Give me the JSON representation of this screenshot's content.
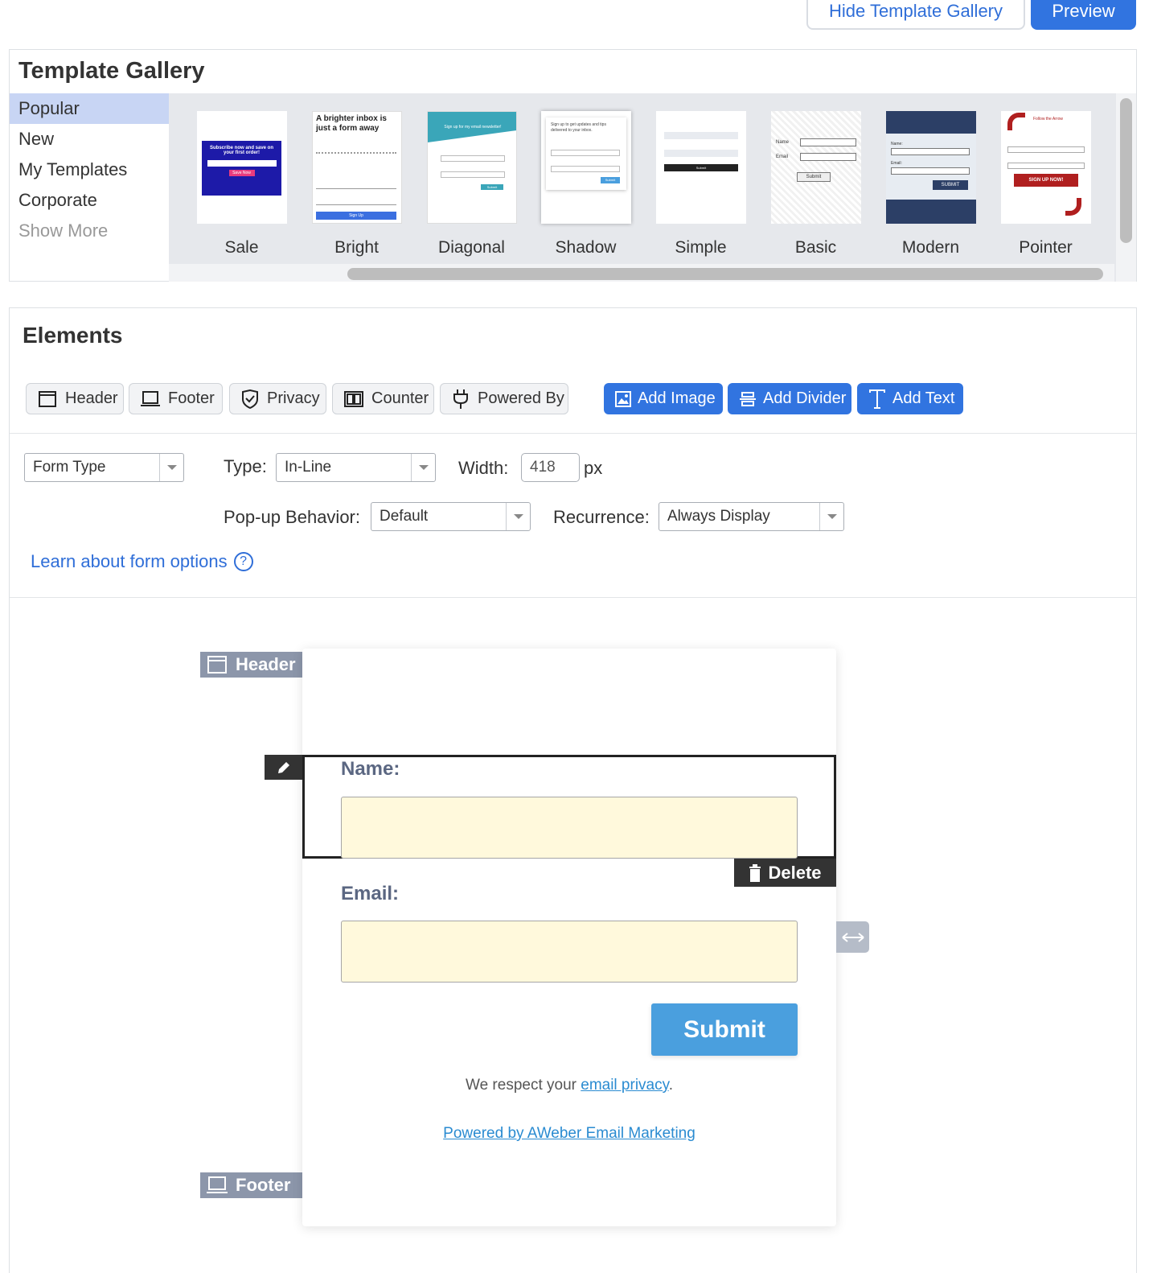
{
  "top_buttons": {
    "hide_gallery": "Hide Template Gallery",
    "preview": "Preview"
  },
  "gallery": {
    "title": "Template Gallery",
    "categories": [
      "Popular",
      "New",
      "My Templates",
      "Corporate"
    ],
    "show_more": "Show More",
    "templates": [
      {
        "label": "Sale",
        "mini_text": [
          "Subscribe now and save on your first order!",
          "Save Now"
        ]
      },
      {
        "label": "Bright",
        "mini_text": [
          "A brighter inbox is just a form away",
          "Sign Up"
        ]
      },
      {
        "label": "Diagonal",
        "mini_text": [
          "Sign up for my email newsletter!",
          "Submit"
        ]
      },
      {
        "label": "Shadow",
        "mini_text": [
          "Sign up to get updates and tips delivered to your inbox.",
          "Submit"
        ]
      },
      {
        "label": "Simple",
        "mini_text": [
          "Submit"
        ]
      },
      {
        "label": "Basic",
        "mini_text": [
          "Name",
          "Email",
          "Submit"
        ]
      },
      {
        "label": "Modern",
        "mini_text": [
          "Name:",
          "Email:",
          "SUBMIT"
        ]
      },
      {
        "label": "Pointer",
        "mini_text": [
          "Follow the Arrow",
          "SIGN UP NOW!"
        ]
      }
    ]
  },
  "elements": {
    "title": "Elements",
    "toggles": [
      "Header",
      "Footer",
      "Privacy",
      "Counter",
      "Powered By"
    ],
    "add_buttons": [
      "Add Image",
      "Add Divider",
      "Add Text"
    ]
  },
  "options": {
    "form_type": "Form Type",
    "type_label": "Type:",
    "type_value": "In-Line",
    "width_label": "Width:",
    "width_value": "418",
    "width_unit": "px",
    "popup_label": "Pop-up Behavior:",
    "popup_value": "Default",
    "recurrence_label": "Recurrence:",
    "recurrence_value": "Always Display",
    "learn_link": "Learn about form options",
    "help_glyph": "?"
  },
  "canvas": {
    "header_tag": "Header",
    "footer_tag": "Footer",
    "name_label": "Name:",
    "email_label": "Email:",
    "delete_label": "Delete",
    "submit_label": "Submit",
    "privacy_prefix": "We respect your ",
    "privacy_link": "email privacy",
    "privacy_suffix": ".",
    "powered_by": "Powered by AWeber Email Marketing"
  },
  "colors": {
    "accent": "#3174e0",
    "submit": "#4a9fde",
    "field_bg": "#fff9dc",
    "active_category": "#c8d5f4"
  }
}
